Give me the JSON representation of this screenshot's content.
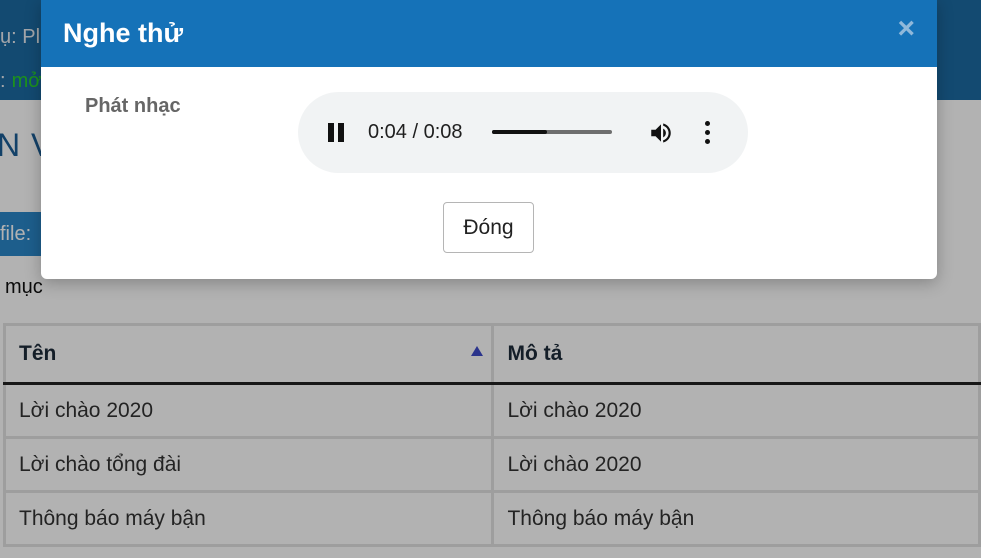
{
  "background": {
    "topbar": {
      "line1": "ụ: Pl",
      "line2_prefix": ":",
      "line2_status": "mở"
    },
    "page_title": "N V",
    "file_button": "file:",
    "section_label": "mục",
    "table": {
      "columns": [
        "Tên",
        "Mô tả"
      ],
      "rows": [
        {
          "name": "Lời chào 2020",
          "desc": "Lời chào 2020"
        },
        {
          "name": "Lời chào tổng đài",
          "desc": "Lời chào 2020"
        },
        {
          "name": "Thông báo máy bận",
          "desc": "Thông báo máy bận"
        }
      ]
    }
  },
  "modal": {
    "title": "Nghe thử",
    "close_icon": "×",
    "field_label": "Phát nhạc",
    "audio": {
      "time": "0:04 / 0:08",
      "progress": 0.46,
      "state_icon": "pause-icon"
    },
    "close_button": "Đóng"
  },
  "colors": {
    "header": "#1572b8",
    "topbar": "#1c6aa3",
    "status_green": "#29d129",
    "sort_arrow": "#3e4bc9"
  }
}
